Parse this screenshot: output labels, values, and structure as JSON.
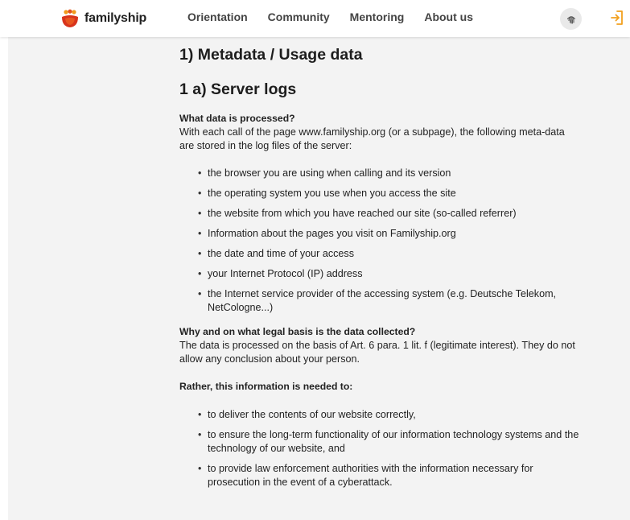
{
  "header": {
    "brand": "familyship",
    "nav": [
      "Orientation",
      "Community",
      "Mentoring",
      "About us"
    ],
    "colors": {
      "brand_red": "#d8341c",
      "brand_orange": "#f19a1a",
      "accent": "#f2a01e"
    },
    "icons": {
      "fingerprint": "fingerprint-icon",
      "login": "login-icon"
    }
  },
  "main": {
    "heading1": "1) Metadata / Usage data",
    "heading2": "1 a) Server logs",
    "q1": "What data is processed?",
    "q1_text": "With each call of the page www.familyship.org (or a subpage), the following meta-data are stored in the log files of the server:",
    "list1": [
      "the browser you are using when calling and its version",
      "the operating system you use when you access the site",
      "the website from which you have reached our site (so-called referrer)",
      "Information about the pages you visit on Familyship.org",
      "the date and time of your access",
      "your Internet Protocol (IP) address",
      "the Internet service provider of the accessing system (e.g. Deutsche Telekom, NetCologne...)"
    ],
    "q2": "Why and on what legal basis is the data collected?",
    "q2_text": "The data is processed on the basis of Art. 6 para. 1 lit. f (legitimate interest). They do not allow any conclusion about your person.",
    "rather": "Rather, this information is needed to:",
    "list2": [
      "to deliver the contents of our website correctly,",
      "to ensure the long-term functionality of our information technology systems and the technology of our website, and",
      "to provide law enforcement authorities with the information necessary for prosecution in the event of a cyberattack."
    ]
  }
}
